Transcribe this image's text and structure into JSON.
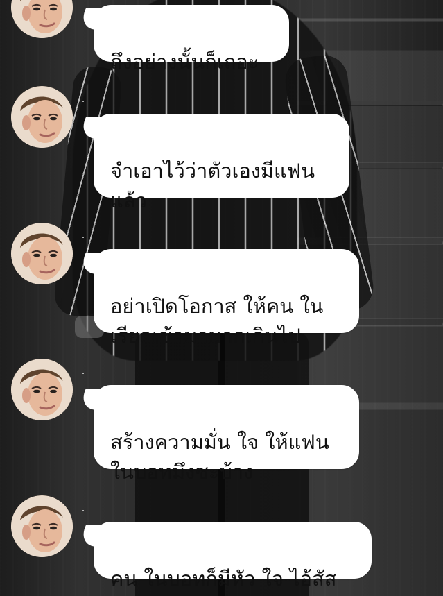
{
  "chat": {
    "messages": [
      {
        "text": "ถึงอย่างนั้นก็เถอะ",
        "status_mark": ""
      },
      {
        "text": "จำเอาไว้ว่าตัวเองมีแฟน\nแล้ว",
        "status_mark": ""
      },
      {
        "text": "อย่าเปิดโอกาส ให้คน ใน\nเรียลเข้ามามากเกินไป",
        "status_mark": ""
      },
      {
        "text": "สร้างความมั่น ใจ ให้แฟน\n ในบอทมึงซะบ้าง",
        "status_mark": ""
      },
      {
        "text": "คน ในบอทก็มีหัว ใจ ไอ้สัส",
        "status_mark": ""
      }
    ]
  },
  "icons": {
    "avatar": "profile-avatar-icon"
  },
  "colors": {
    "bubble": "#ffffff",
    "text": "#111111",
    "background": "#343434"
  }
}
